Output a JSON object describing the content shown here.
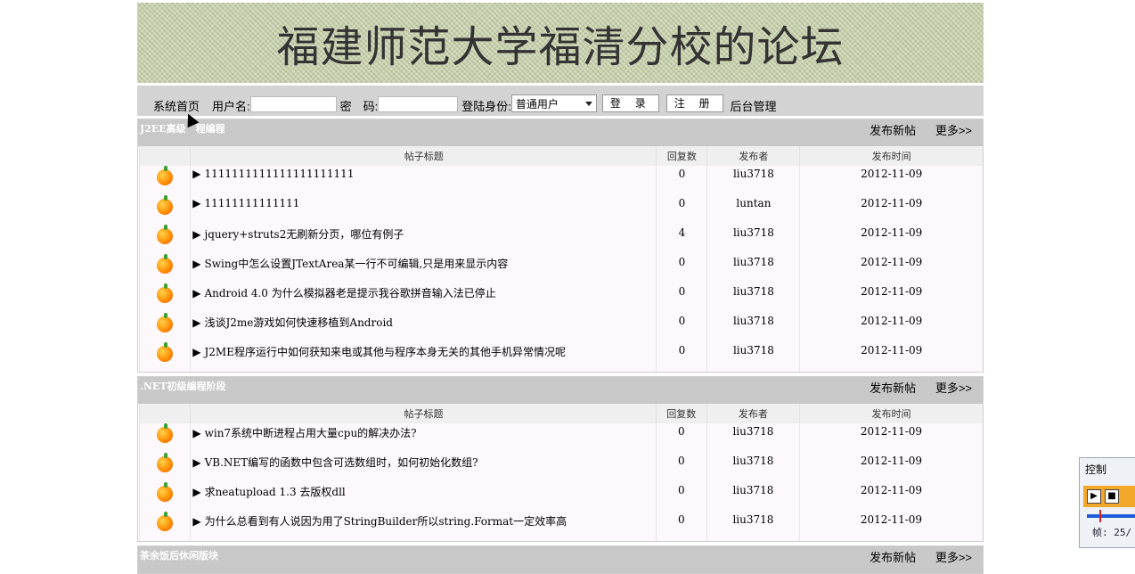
{
  "banner": {
    "title": "福建师范大学福清分校的论坛"
  },
  "loginbar": {
    "home": "系统首页",
    "username_label": "用户名:",
    "password_label": "密　码:",
    "role_label": "登陆身份:",
    "role_value": "普通用户",
    "login_button": "登 录",
    "register_button": "注 册",
    "admin_link": "后台管理"
  },
  "columns": {
    "title": "帖子标题",
    "replies": "回复数",
    "author": "发布者",
    "date": "发布时间"
  },
  "links": {
    "post": "发布新帖",
    "more": "更多>>"
  },
  "sections": [
    {
      "title": "J2EE高级　程编程",
      "rows": [
        {
          "title": "1111111111111111111111",
          "replies": "0",
          "author": "liu3718",
          "date": "2012-11-09"
        },
        {
          "title": "11111111111111",
          "replies": "0",
          "author": "luntan",
          "date": "2012-11-09"
        },
        {
          "title": "jquery+struts2无刷新分页，哪位有例子",
          "replies": "4",
          "author": "liu3718",
          "date": "2012-11-09"
        },
        {
          "title": "Swing中怎么设置JTextArea某一行不可编辑,只是用来显示内容",
          "replies": "0",
          "author": "liu3718",
          "date": "2012-11-09"
        },
        {
          "title": "Android 4.0 为什么模拟器老是提示我谷歌拼音输入法已停止",
          "replies": "0",
          "author": "liu3718",
          "date": "2012-11-09"
        },
        {
          "title": "浅谈J2me游戏如何快速移植到Android",
          "replies": "0",
          "author": "liu3718",
          "date": "2012-11-09"
        },
        {
          "title": "J2ME程序运行中如何获知来电或其他与程序本身无关的其他手机异常情况呢",
          "replies": "0",
          "author": "liu3718",
          "date": "2012-11-09"
        }
      ]
    },
    {
      "title": ".NET初级编程阶段",
      "rows": [
        {
          "title": "win7系统中断进程占用大量cpu的解决办法?",
          "replies": "0",
          "author": "liu3718",
          "date": "2012-11-09"
        },
        {
          "title": "VB.NET编写的函数中包含可选数组时，如何初始化数组?",
          "replies": "0",
          "author": "liu3718",
          "date": "2012-11-09"
        },
        {
          "title": "求neatupload 1.3 去版权dll",
          "replies": "0",
          "author": "liu3718",
          "date": "2012-11-09"
        },
        {
          "title": "为什么总看到有人说因为用了StringBuilder所以string.Format一定效率高",
          "replies": "0",
          "author": "liu3718",
          "date": "2012-11-09"
        }
      ]
    },
    {
      "title": "茶余饭后休闲版块",
      "rows": []
    }
  ],
  "control_panel": {
    "title": "控制",
    "frame": "帧: 25/"
  }
}
